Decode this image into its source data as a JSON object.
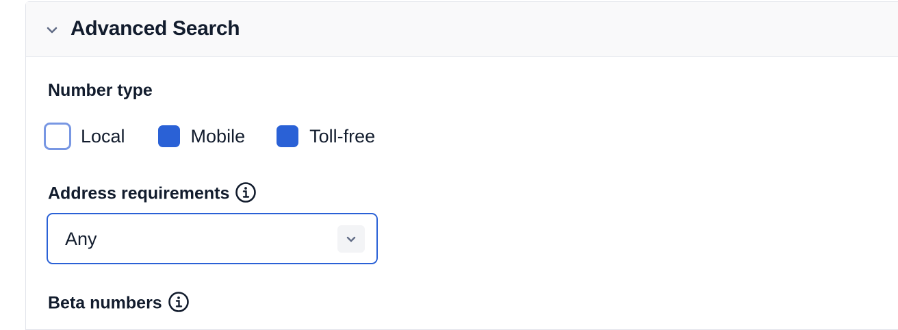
{
  "panel": {
    "title": "Advanced Search",
    "chevron_icon": "chevron-down-icon"
  },
  "number_type": {
    "label": "Number type",
    "options": [
      {
        "label": "Local",
        "checked": false
      },
      {
        "label": "Mobile",
        "checked": true
      },
      {
        "label": "Toll-free",
        "checked": true
      }
    ]
  },
  "address_requirements": {
    "label": "Address requirements",
    "info_icon": "info-icon",
    "selected": "Any"
  },
  "beta_numbers": {
    "label": "Beta numbers",
    "info_icon": "info-icon"
  },
  "colors": {
    "accent": "#2a61d6",
    "focus_ring": "#7897e3",
    "header_bg": "#f9f9fa",
    "text": "#121c2d"
  }
}
